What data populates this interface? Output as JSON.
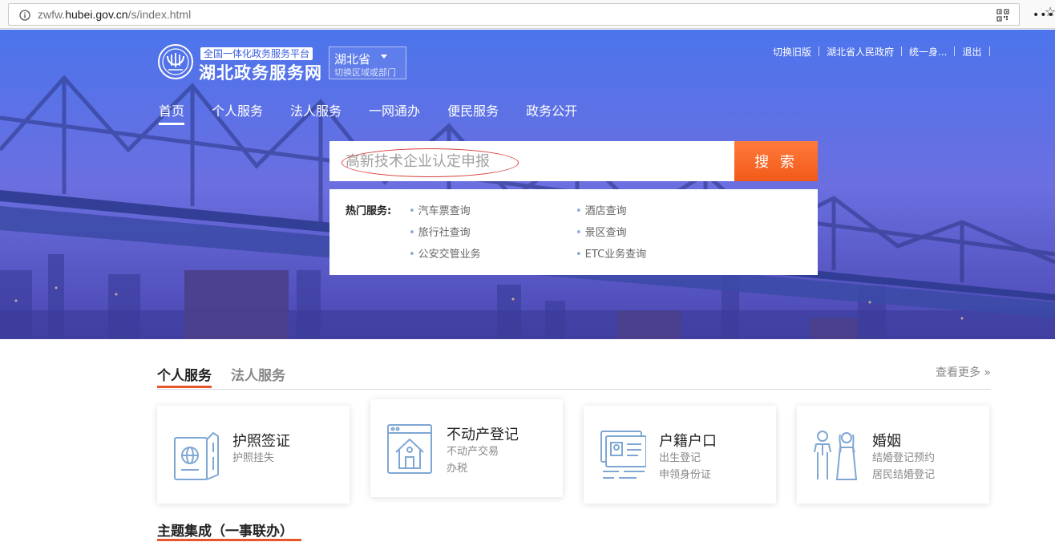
{
  "browser": {
    "url_prefix": "zwfw.",
    "url_domain": "hubei.gov.cn",
    "url_path": "/s/index.html",
    "more_menu": "•••"
  },
  "header": {
    "platform_badge": "全国一体化政务服务平台",
    "site_name": "湖北政务服务网",
    "region_name": "湖北省",
    "region_sub": "切换区域或部门",
    "top_links": [
      "切换旧版",
      "湖北省人民政府",
      "统一身...",
      "退出"
    ]
  },
  "nav": {
    "items": [
      "首页",
      "个人服务",
      "法人服务",
      "一网通办",
      "便民服务",
      "政务公开"
    ],
    "active_index": 0
  },
  "search": {
    "placeholder": "高新技术企业认定申报",
    "button_label": "搜 索"
  },
  "hot_services": {
    "title": "热门服务:",
    "items": [
      "汽车票查询",
      "酒店查询",
      "旅行社查询",
      "景区查询",
      "公安交管业务",
      "ETC业务查询"
    ]
  },
  "service_tabs": {
    "active": "个人服务",
    "inactive": "法人服务",
    "more": "查看更多 »"
  },
  "cards": [
    {
      "title": "护照签证",
      "subs": [
        "护照挂失"
      ],
      "icon": "passport-icon"
    },
    {
      "title": "不动产登记",
      "subs": [
        "不动产交易",
        "办税"
      ],
      "icon": "house-icon"
    },
    {
      "title": "户籍户口",
      "subs": [
        "出生登记",
        "申领身份证"
      ],
      "icon": "id-card-icon"
    },
    {
      "title": "婚姻",
      "subs": [
        "结婚登记预约",
        "居民结婚登记"
      ],
      "icon": "couple-icon"
    }
  ],
  "theme": {
    "title": "主题集成（一事联办）"
  },
  "colors": {
    "accent_orange": "#f25a18",
    "hero_blue": "#4a6fe8",
    "icon_blue": "#7fa7d4"
  }
}
